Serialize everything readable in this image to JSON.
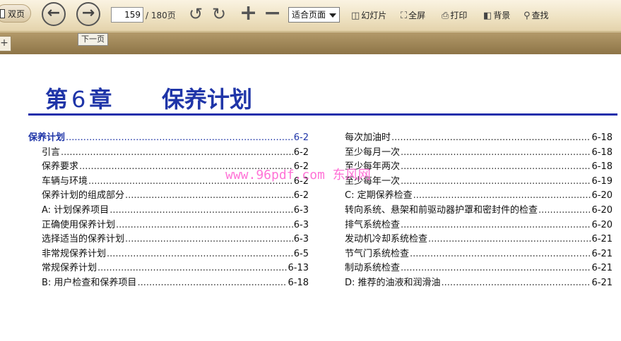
{
  "toolbar": {
    "dual_page_label": "双页",
    "page_current": "159",
    "page_total": "/ 180页",
    "zoom_value": "适合页面",
    "slideshow_label": "幻灯片",
    "fullscreen_label": "全屏",
    "print_label": "打印",
    "background_label": "背景",
    "search_label": "查找",
    "icons": {
      "prev": "arrow-left-circle",
      "next": "arrow-right-circle",
      "rotate_left": "rotate-ccw",
      "rotate_right": "rotate-cw",
      "zoom_in": "plus",
      "zoom_out": "minus",
      "slideshow": "projector",
      "fullscreen": "expand",
      "print": "printer",
      "background": "layers",
      "search": "magnifier"
    }
  },
  "tooltip": "下一页",
  "add_tab_label": "+",
  "doc": {
    "chapter_prefix": "第",
    "chapter_number": "6",
    "chapter_suffix": "章",
    "chapter_title": "保养计划",
    "watermark": "www.96pdf.com 东风网",
    "toc_left": [
      {
        "title": "保养计划",
        "page": "6-2",
        "level": 0
      },
      {
        "title": "引言",
        "page": "6-2",
        "level": 1
      },
      {
        "title": "保养要求",
        "page": "6-2",
        "level": 1
      },
      {
        "title": "车辆与环境",
        "page": "6-2",
        "level": 1
      },
      {
        "title": "保养计划的组成部分",
        "page": "6-2",
        "level": 1
      },
      {
        "title": "A: 计划保养项目",
        "page": "6-3",
        "level": 1
      },
      {
        "title": "正确使用保养计划",
        "page": "6-3",
        "level": 1
      },
      {
        "title": "选择适当的保养计划",
        "page": "6-3",
        "level": 1
      },
      {
        "title": "非常规保养计划",
        "page": "6-5",
        "level": 1
      },
      {
        "title": "常规保养计划",
        "page": "6-13",
        "level": 1
      },
      {
        "title": "B: 用户检查和保养项目",
        "page": "6-18",
        "level": 1
      }
    ],
    "toc_right": [
      {
        "title": "每次加油时",
        "page": "6-18"
      },
      {
        "title": "至少每月一次",
        "page": "6-18"
      },
      {
        "title": "至少每年两次",
        "page": "6-18"
      },
      {
        "title": "至少每年一次",
        "page": "6-19"
      },
      {
        "title": "C: 定期保养检查",
        "page": "6-20"
      },
      {
        "title": "转向系统、悬架和前驱动器护罩和密封件的检查",
        "page": "6-20"
      },
      {
        "title": "排气系统检查",
        "page": "6-20"
      },
      {
        "title": "发动机冷却系统检查",
        "page": "6-21"
      },
      {
        "title": "节气门系统检查",
        "page": "6-21"
      },
      {
        "title": "制动系统检查",
        "page": "6-21"
      },
      {
        "title": "D: 推荐的油液和润滑油",
        "page": "6-21"
      }
    ]
  },
  "colors": {
    "accent_blue": "#1f35a8",
    "watermark": "#ff5ad0",
    "toolbar_bg": "#efe3c4",
    "subbar_bg": "#9e8557"
  }
}
